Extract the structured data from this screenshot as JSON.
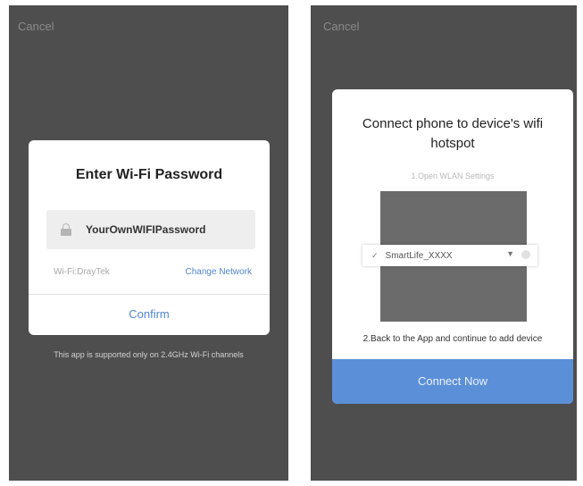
{
  "left_screen": {
    "cancel_label": "Cancel",
    "dialog": {
      "title": "Enter Wi-Fi Password",
      "password_value": "YourOwnWIFIPassword",
      "network_name": "Wi-Fi:DrayTek",
      "change_network_label": "Change Network",
      "confirm_label": "Confirm"
    },
    "note": "This app is supported only on 2.4GHz Wi-Fi channels"
  },
  "right_screen": {
    "cancel_label": "Cancel",
    "dialog": {
      "title": "Connect phone to device's wifi hotspot",
      "step1": "1.Open WLAN Settings",
      "wifi_item_ssid": "SmartLife_XXXX",
      "step2": "2.Back to the App and continue to add device",
      "connect_label": "Connect Now"
    }
  },
  "icons": {
    "lock": "lock-icon",
    "check": "check-icon",
    "wifi": "wifi-icon",
    "info": "info-icon"
  },
  "colors": {
    "accent": "#4f86d4",
    "button": "#5b8fd8",
    "screen_background": "#4e4e4e"
  }
}
